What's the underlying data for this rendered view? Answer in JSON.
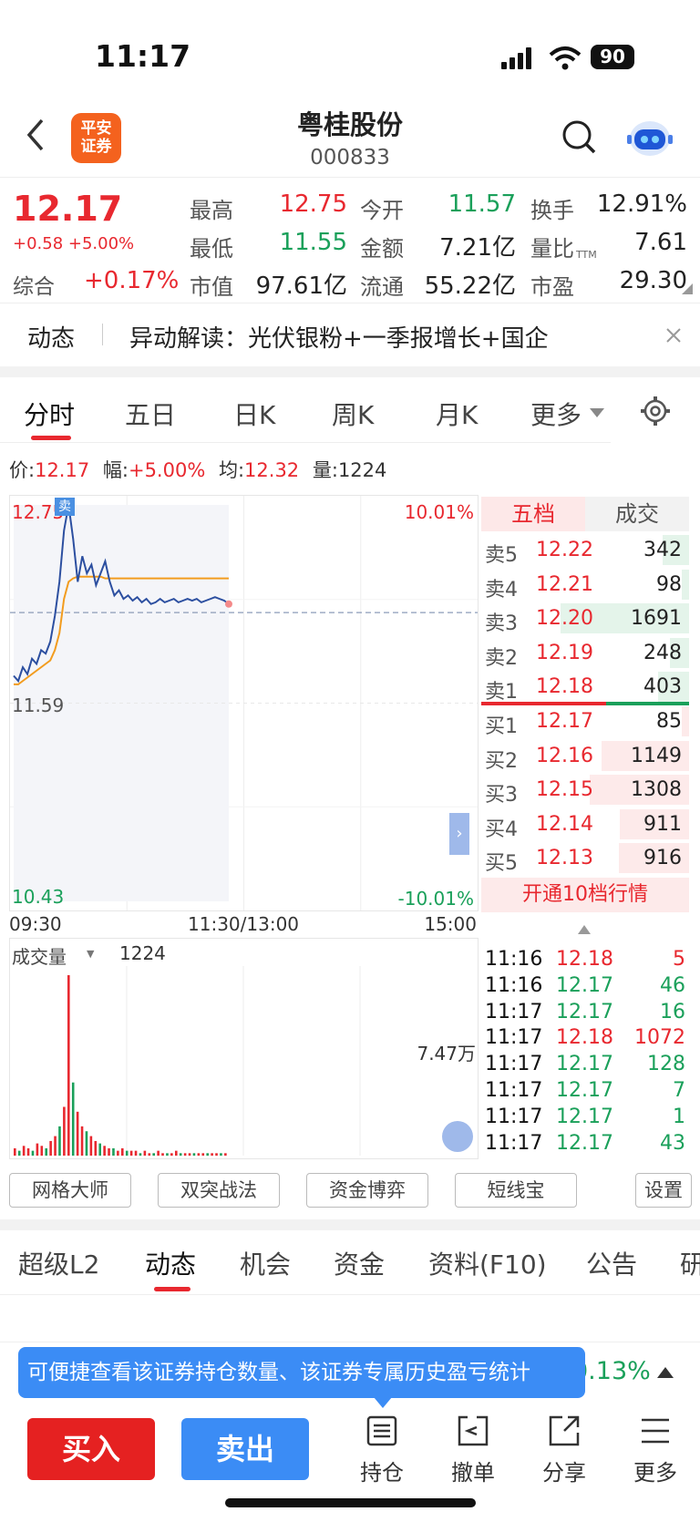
{
  "status": {
    "time": "11:17",
    "battery": "90"
  },
  "header": {
    "logo_text": "平安证券",
    "stock_name": "粤桂股份",
    "stock_code": "000833"
  },
  "quote": {
    "price": "12.17",
    "change": "+0.58 +5.00%",
    "zonghe_label": "综合",
    "zonghe_value": "+0.17%",
    "fields": [
      {
        "label": "最高",
        "value": "12.75",
        "color": "red"
      },
      {
        "label": "今开",
        "value": "11.57",
        "color": "green"
      },
      {
        "label": "换手",
        "value": "12.91%",
        "color": "dark"
      },
      {
        "label": "最低",
        "value": "11.55",
        "color": "green"
      },
      {
        "label": "金额",
        "value": "7.21亿",
        "color": "dark"
      },
      {
        "label": "量比",
        "value": "7.61",
        "color": "dark"
      },
      {
        "label": "市值",
        "value": "97.61亿",
        "color": "dark"
      },
      {
        "label": "流通",
        "value": "55.22亿",
        "color": "dark"
      },
      {
        "label": "市盈",
        "value": "29.30",
        "color": "dark"
      }
    ],
    "pe_sup": "TTM"
  },
  "news": {
    "label": "动态",
    "text": "异动解读：光伏银粉+一季报增长+国企"
  },
  "chart_tabs": [
    "分时",
    "五日",
    "日K",
    "周K",
    "月K",
    "更多"
  ],
  "info": {
    "price_label": "价:",
    "price": "12.17",
    "amp_label": "幅:",
    "amp": "+5.00%",
    "avg_label": "均:",
    "avg": "12.32",
    "vol_label": "量:",
    "vol": "1224"
  },
  "chart_data": {
    "type": "line",
    "y_left_labels": [
      "12.75",
      "11.59",
      "10.43"
    ],
    "y_right_labels": [
      "10.01%",
      "-10.01%"
    ],
    "x_labels": [
      "09:30",
      "11:30/13:00",
      "15:00"
    ],
    "ylim": [
      10.43,
      12.75
    ],
    "prev_close": 11.59,
    "sell_marker": "卖",
    "price_series": [
      11.75,
      11.72,
      11.8,
      11.76,
      11.85,
      11.82,
      11.9,
      11.88,
      11.95,
      12.1,
      12.3,
      12.6,
      12.75,
      12.55,
      12.3,
      12.45,
      12.35,
      12.4,
      12.28,
      12.35,
      12.42,
      12.3,
      12.22,
      12.25,
      12.2,
      12.22,
      12.19,
      12.21,
      12.18,
      12.2,
      12.17,
      12.18,
      12.2,
      12.18,
      12.19,
      12.2,
      12.18,
      12.19,
      12.2,
      12.19,
      12.2,
      12.18,
      12.19,
      12.2,
      12.21,
      12.2,
      12.19,
      12.17
    ],
    "avg_series": [
      11.7,
      11.7,
      11.72,
      11.74,
      11.76,
      11.78,
      11.8,
      11.82,
      11.84,
      11.9,
      12.0,
      12.2,
      12.3,
      12.32,
      12.33,
      12.33,
      12.33,
      12.33,
      12.33,
      12.33,
      12.32,
      12.32,
      12.32,
      12.32,
      12.32,
      12.32,
      12.32,
      12.32,
      12.32,
      12.32,
      12.32,
      12.32,
      12.32,
      12.32,
      12.32,
      12.32,
      12.32,
      12.32,
      12.32,
      12.32,
      12.32,
      12.32,
      12.32,
      12.32,
      12.32,
      12.32,
      12.32,
      12.32
    ],
    "volume_label": "成交量",
    "volume_value": "1224",
    "volume_max_label": "7.47万",
    "volume_series": [
      3,
      2,
      4,
      3,
      2,
      5,
      4,
      3,
      6,
      8,
      12,
      20,
      74,
      30,
      18,
      12,
      10,
      8,
      6,
      5,
      4,
      3,
      3,
      2,
      3,
      2,
      2,
      2,
      1,
      2,
      1,
      1,
      2,
      1,
      1,
      1,
      2,
      1,
      1,
      1,
      1,
      1,
      1,
      1,
      1,
      1,
      1,
      1
    ]
  },
  "orderbook": {
    "tab_active": "五档",
    "tab_other": "成交",
    "rows": [
      {
        "label": "卖5",
        "price": "12.22",
        "vol": "342"
      },
      {
        "label": "卖4",
        "price": "12.21",
        "vol": "98"
      },
      {
        "label": "卖3",
        "price": "12.20",
        "vol": "1691"
      },
      {
        "label": "卖2",
        "price": "12.19",
        "vol": "248"
      },
      {
        "label": "卖1",
        "price": "12.18",
        "vol": "403"
      },
      {
        "label": "买1",
        "price": "12.17",
        "vol": "85"
      },
      {
        "label": "买2",
        "price": "12.16",
        "vol": "1149"
      },
      {
        "label": "买3",
        "price": "12.15",
        "vol": "1308"
      },
      {
        "label": "买4",
        "price": "12.14",
        "vol": "911"
      },
      {
        "label": "买5",
        "price": "12.13",
        "vol": "916"
      }
    ],
    "upgrade": "开通10档行情"
  },
  "trades": [
    {
      "time": "11:16",
      "price": "12.18",
      "vol": "5",
      "color": "red"
    },
    {
      "time": "11:16",
      "price": "12.17",
      "vol": "46",
      "color": "green"
    },
    {
      "time": "11:17",
      "price": "12.17",
      "vol": "16",
      "color": "green"
    },
    {
      "time": "11:17",
      "price": "12.18",
      "vol": "1072",
      "color": "red"
    },
    {
      "time": "11:17",
      "price": "12.17",
      "vol": "128",
      "color": "green"
    },
    {
      "time": "11:17",
      "price": "12.17",
      "vol": "7",
      "color": "green"
    },
    {
      "time": "11:17",
      "price": "12.17",
      "vol": "1",
      "color": "green"
    },
    {
      "time": "11:17",
      "price": "12.17",
      "vol": "43",
      "color": "green"
    }
  ],
  "tools": [
    "网格大师",
    "双突战法",
    "资金博弈",
    "短线宝",
    "设置"
  ],
  "section_tabs": [
    "超级L2",
    "动态",
    "机会",
    "资金",
    "资料(F10)",
    "公告",
    "研"
  ],
  "tooltip": {
    "text": "可便捷查看该证券持仓数量、该证券专属历史盈亏统计",
    "partial_value": "0.13%"
  },
  "bottom": {
    "buy": "买入",
    "sell": "卖出",
    "icons": [
      "持仓",
      "撤单",
      "分享",
      "更多"
    ]
  },
  "colors": {
    "red": "#e8282f",
    "green": "#1aa05a",
    "blue": "#3b8cf5",
    "orange": "#f4621e"
  }
}
